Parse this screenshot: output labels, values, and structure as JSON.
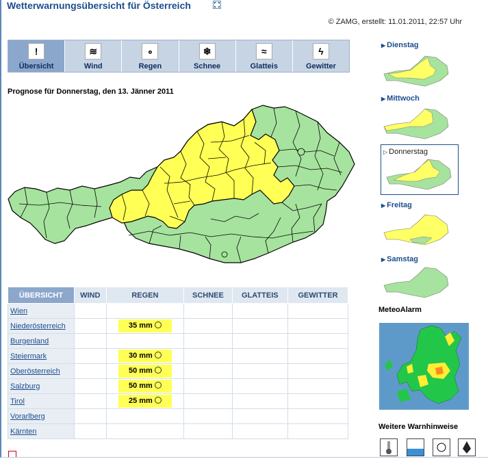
{
  "header": {
    "title": "Wetterwarnungsübersicht für Österreich",
    "credit": "© ZAMG, erstellt: 11.01.2011, 22:57 Uhr"
  },
  "tabs": [
    {
      "label": "Übersicht",
      "icon": "exclamation-icon",
      "glyph": "!"
    },
    {
      "label": "Wind",
      "icon": "windsock-icon",
      "glyph": "≋"
    },
    {
      "label": "Regen",
      "icon": "rain-icon",
      "glyph": "∘"
    },
    {
      "label": "Schnee",
      "icon": "snowflake-icon",
      "glyph": "❄"
    },
    {
      "label": "Glatteis",
      "icon": "ice-icon",
      "glyph": "≈"
    },
    {
      "label": "Gewitter",
      "icon": "lightning-icon",
      "glyph": "ϟ"
    }
  ],
  "prognose": "Prognose für Donnerstag, den 13. Jänner 2011",
  "table": {
    "headers": [
      "ÜBERSICHT",
      "WIND",
      "REGEN",
      "SCHNEE",
      "GLATTEIS",
      "GEWITTER"
    ],
    "rows": [
      {
        "region": "Wien",
        "regen": ""
      },
      {
        "region": "Niederösterreich",
        "regen": "35 mm"
      },
      {
        "region": "Burgenland",
        "regen": ""
      },
      {
        "region": "Steiermark",
        "regen": "30 mm"
      },
      {
        "region": "Oberösterreich",
        "regen": "50 mm"
      },
      {
        "region": "Salzburg",
        "regen": "50 mm"
      },
      {
        "region": "Tirol",
        "regen": "25 mm"
      },
      {
        "region": "Vorarlberg",
        "regen": ""
      },
      {
        "region": "Kärnten",
        "regen": ""
      }
    ]
  },
  "days": [
    {
      "label": "Dienstag"
    },
    {
      "label": "Mittwoch"
    },
    {
      "label": "Donnerstag"
    },
    {
      "label": "Freitag"
    },
    {
      "label": "Samstag"
    }
  ],
  "side": {
    "meteo_title": "MeteoAlarm",
    "weitere_title": "Weitere Warnhinweise"
  },
  "colors": {
    "warn_yellow": "#ffff66",
    "safe_green": "#a6e39e",
    "accent": "#1b4d8c"
  }
}
